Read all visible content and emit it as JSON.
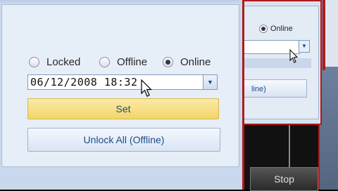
{
  "front_window": {
    "radios": [
      {
        "label": "Locked",
        "selected": false
      },
      {
        "label": "Offline",
        "selected": false
      },
      {
        "label": "Online",
        "selected": true
      }
    ],
    "datetime_value": "06/12/2008 18:32",
    "set_button": "Set",
    "unlock_button": "Unlock All (Offline)",
    "accent_color": "#f2d56b"
  },
  "middle_window": {
    "radio_label": "Online",
    "button_label": "line)"
  },
  "bottom_button": {
    "label": "Stop"
  }
}
